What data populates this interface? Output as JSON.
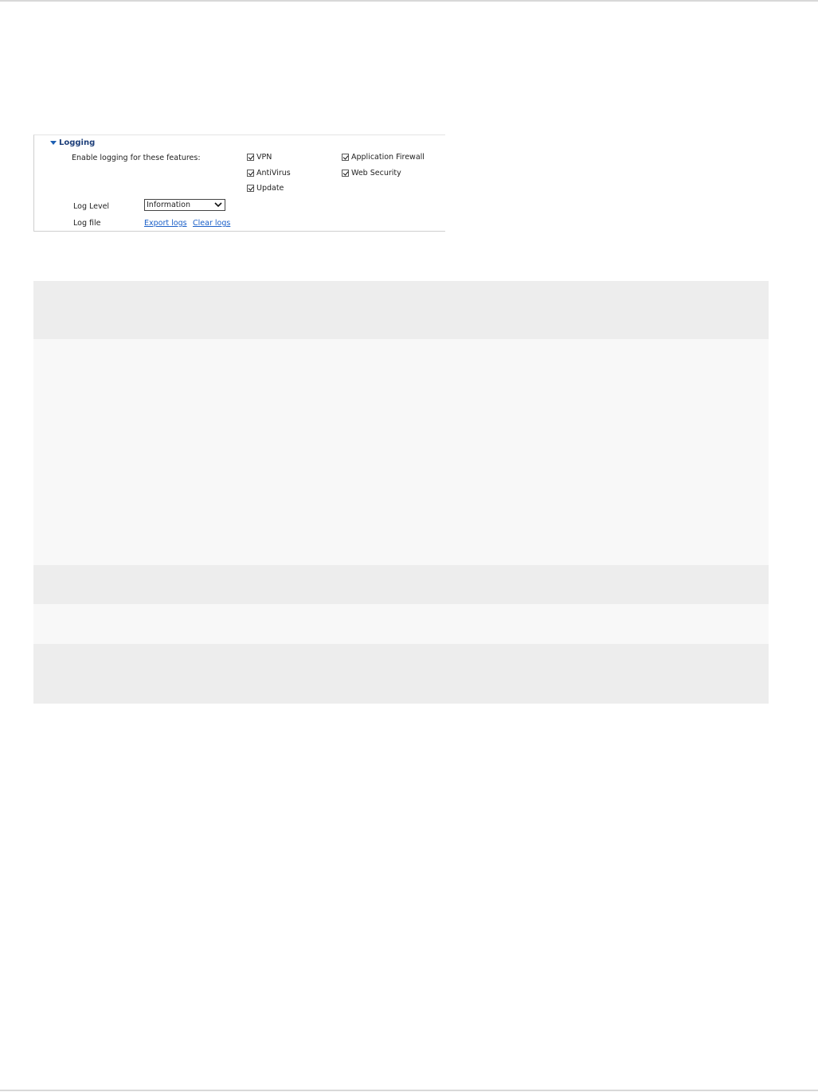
{
  "logging": {
    "title": "Logging",
    "enable_label": "Enable logging for these features:",
    "features": {
      "vpn": "VPN",
      "application_firewall": "Application Firewall",
      "antivirus": "AntiVirus",
      "web_security": "Web Security",
      "update": "Update"
    },
    "log_level_label": "Log Level",
    "log_level_value": "Information",
    "log_file_label": "Log file",
    "export_logs": "Export logs",
    "clear_logs": "Clear logs"
  }
}
